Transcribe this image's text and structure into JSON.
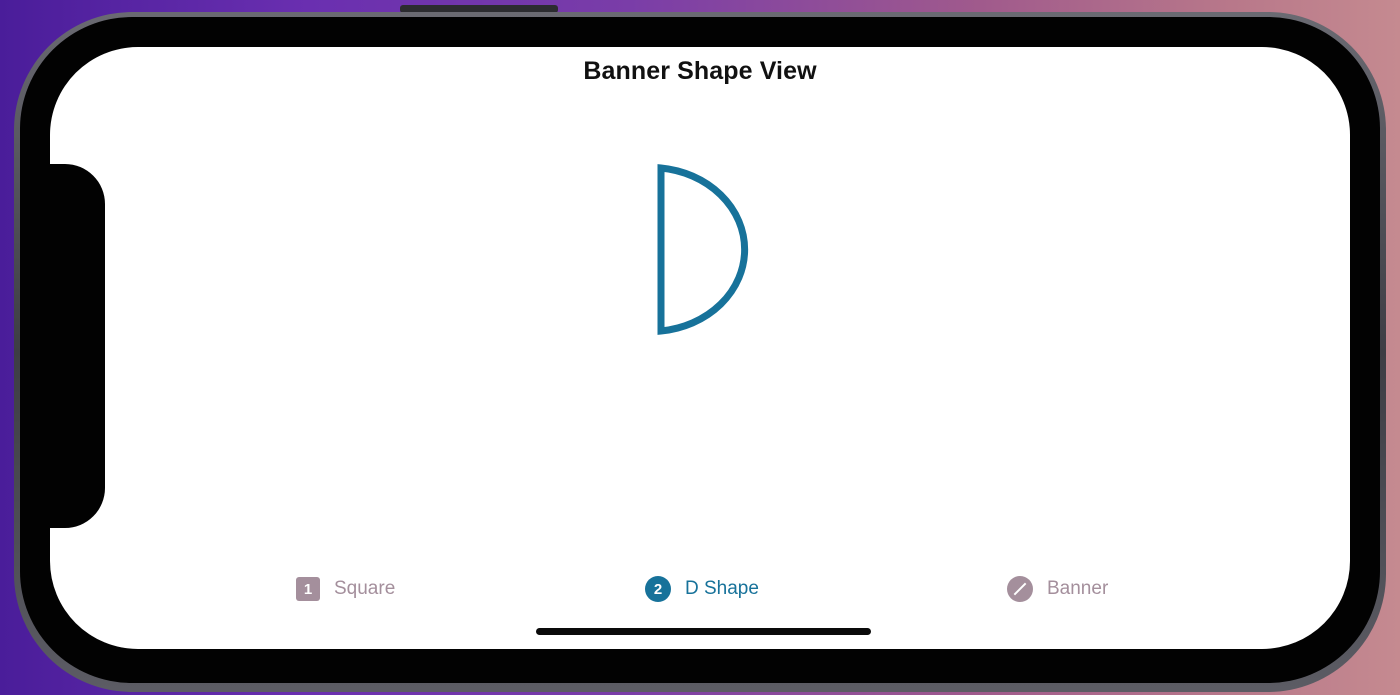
{
  "navigation": {
    "title": "Banner Shape View"
  },
  "main": {
    "shape_name": "d-shape",
    "stroke_color": "#17729a"
  },
  "tab_bar": {
    "selected_index": 1,
    "selected_color": "#17729a",
    "unselected_color": "#a48f9c",
    "items": [
      {
        "label": "Square",
        "icon": "square-1-icon",
        "icon_text": "1"
      },
      {
        "label": "D Shape",
        "icon": "circle-2-icon",
        "icon_text": "2"
      },
      {
        "label": "Banner",
        "icon": "circle-slash-icon"
      }
    ]
  }
}
